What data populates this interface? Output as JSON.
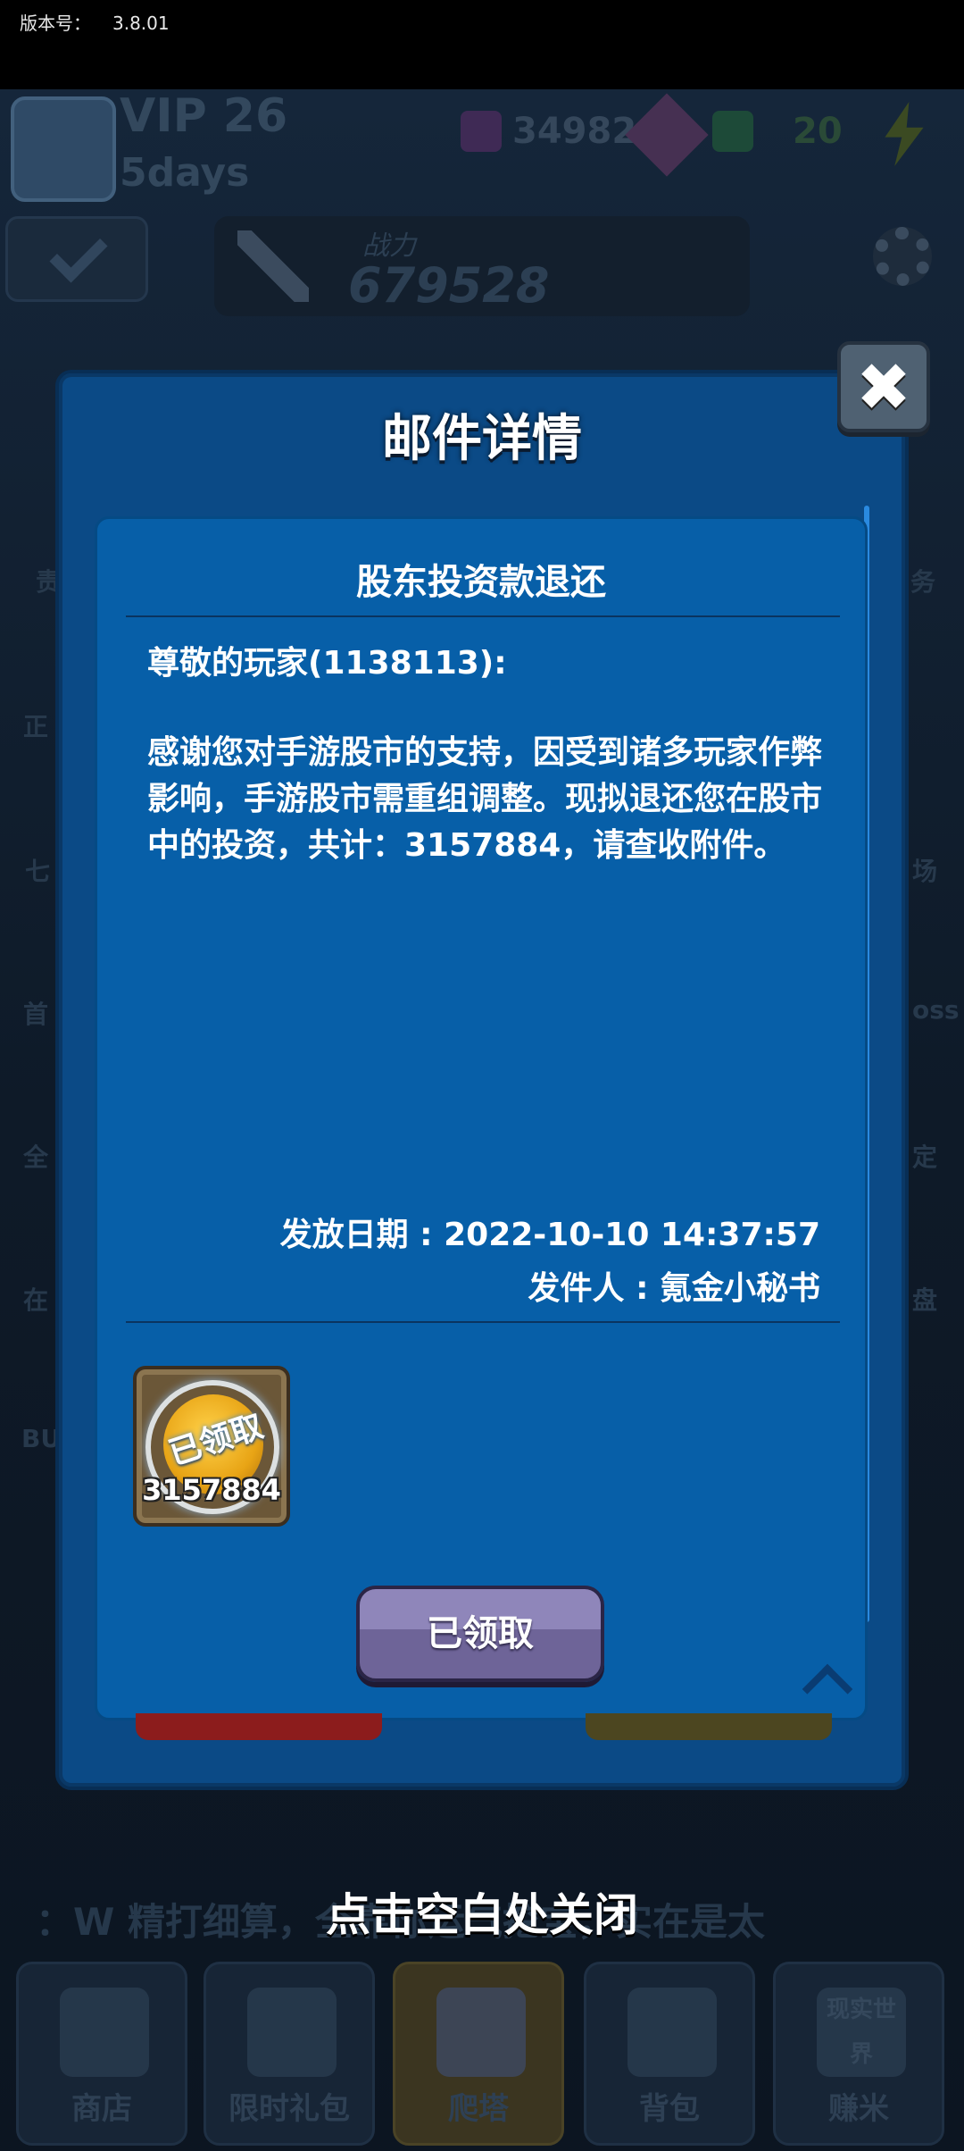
{
  "version": {
    "label": "版本号：",
    "value": "3.8.01"
  },
  "hud": {
    "vip_label": "VIP 26",
    "days": "5days",
    "currency1": "34982",
    "currency2": "20",
    "power_label": "战力",
    "power_value": "679528"
  },
  "side_left": [
    "责",
    "正",
    "七",
    "首",
    "全",
    "在",
    "BU"
  ],
  "side_right": [
    "务",
    "场",
    "oss",
    "定",
    "盘"
  ],
  "marquee": "：W 精打细算，全靠你运气挖宝，实在是太",
  "nav": [
    "商店",
    "限时礼包",
    "爬塔",
    "背包",
    "赚米"
  ],
  "nav_realworld": "现实世界",
  "modal": {
    "title": "邮件详情",
    "close_icon": "close-x",
    "mail_subject": "股东投资款退还",
    "greeting": "尊敬的玩家(1138113):",
    "body": "感谢您对手游股市的支持，因受到诸多玩家作弊影响，手游股市需重组调整。现拟退还您在股市中的投资，共计：3157884，请查收附件。",
    "date_line": "发放日期 : 2022-10-10 14:37:57",
    "sender_line": "发件人 : 氪金小秘书",
    "attachment": {
      "stamp": "已领取",
      "count": "3157884",
      "icon": "gold-coin-icon"
    },
    "claim_button": "已领取"
  },
  "close_hint": "点击空白处关闭"
}
